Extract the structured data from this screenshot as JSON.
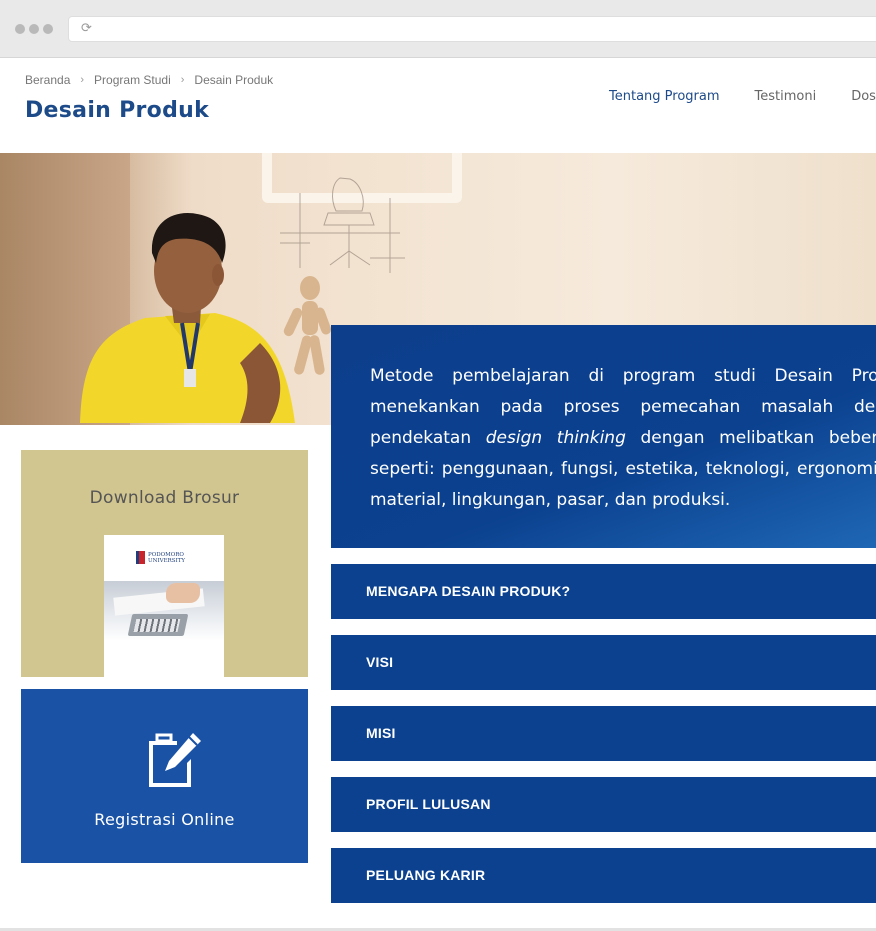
{
  "breadcrumb": {
    "items": [
      "Beranda",
      "Program Studi",
      "Desain Produk"
    ],
    "separator": "›"
  },
  "header": {
    "title": "Desain Produk",
    "tabs": [
      {
        "label": "Tentang Program",
        "active": true
      },
      {
        "label": "Testimoni",
        "active": false
      },
      {
        "label": "Dose",
        "active": false
      }
    ]
  },
  "description": {
    "before": "Metode pembelajaran di program studi Desain Produk menekankan pada proses pemecahan masalah desain pendekatan ",
    "emphasis": "design thinking",
    "after": " dengan melibatkan beberapa seperti: penggunaan, fungsi, estetika, teknologi, ergonomi, ps material, lingkungan, pasar, dan produksi."
  },
  "brochure": {
    "title": "Download Brosur",
    "logo_line1": "PODOMORO",
    "logo_line2": "UNIVERSITY"
  },
  "registration": {
    "label": "Registrasi Online",
    "icon": "edit-document-icon"
  },
  "accordion": [
    {
      "label": "MENGAPA DESAIN PRODUK?"
    },
    {
      "label": "VISI"
    },
    {
      "label": "MISI"
    },
    {
      "label": "PROFIL LULUSAN"
    },
    {
      "label": "PELUANG KARIR"
    }
  ],
  "colors": {
    "primary": "#0b418f",
    "registration": "#1a52a6",
    "brochure_bg": "#d1c590",
    "title": "#1d4b8a"
  }
}
